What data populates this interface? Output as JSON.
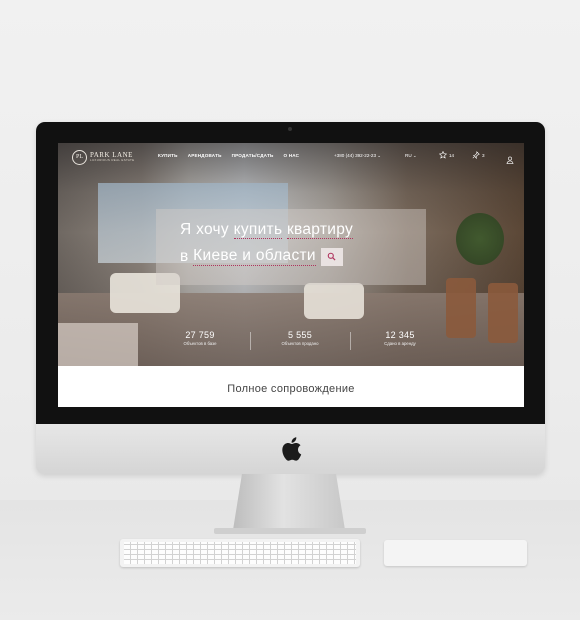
{
  "header": {
    "logo": {
      "mark": "PL",
      "name": "PARK LANE",
      "subtitle": "LUXURIOUS REAL ESTATE"
    },
    "nav": [
      "КУПИТЬ",
      "АРЕНДОВАТЬ",
      "ПРОДАТЬ/СДАТЬ",
      "О НАС"
    ],
    "phone": "+380 (44) 392-22-23",
    "language": "RU",
    "favorites_count": "14",
    "compare_count": "3"
  },
  "hero": {
    "line1_prefix": "Я хочу",
    "action": "купить",
    "property": "квартиру",
    "line2_prefix": "в",
    "location": "Киеве и области"
  },
  "stats": [
    {
      "number": "27 759",
      "label": "Объектов в базе"
    },
    {
      "number": "5 555",
      "label": "Объектов продано"
    },
    {
      "number": "12 345",
      "label": "Сдано в аренду"
    }
  ],
  "section": {
    "title": "Полное сопровождение"
  },
  "icons": {
    "search": "search-icon",
    "favorites": "star-icon",
    "compare": "pin-icon",
    "user": "user-icon",
    "brand": "apple-logo"
  },
  "colors": {
    "accent": "#b0345e",
    "text_dark": "#444444"
  }
}
